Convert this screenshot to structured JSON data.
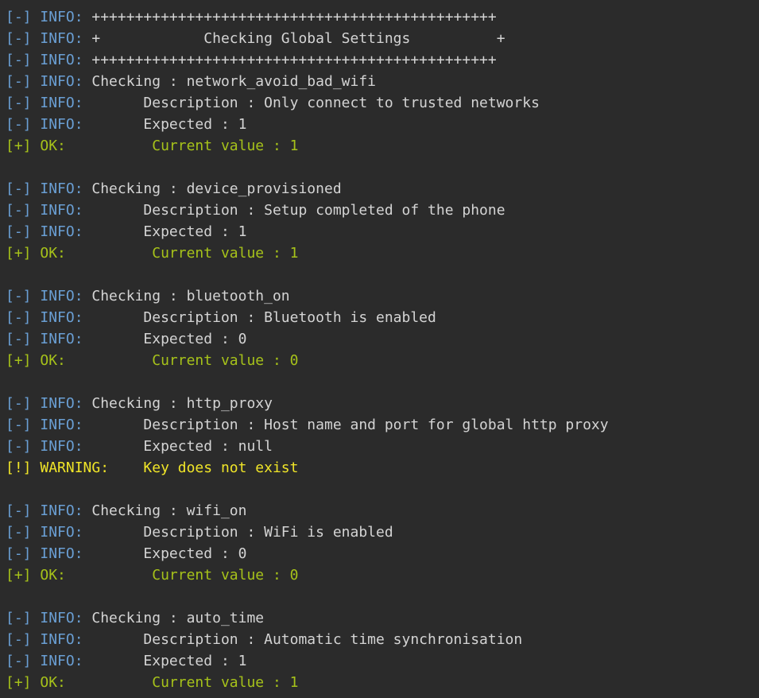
{
  "terminal": {
    "lines": [
      {
        "level": "info",
        "prefix": "[-]",
        "label": "INFO:",
        "text": " +++++++++++++++++++++++++++++++++++++++++++++++"
      },
      {
        "level": "info",
        "prefix": "[-]",
        "label": "INFO:",
        "text": " +            Checking Global Settings          +"
      },
      {
        "level": "info",
        "prefix": "[-]",
        "label": "INFO:",
        "text": " +++++++++++++++++++++++++++++++++++++++++++++++"
      },
      {
        "level": "info",
        "prefix": "[-]",
        "label": "INFO:",
        "text": " Checking : network_avoid_bad_wifi"
      },
      {
        "level": "info",
        "prefix": "[-]",
        "label": "INFO:",
        "text": "       Description : Only connect to trusted networks"
      },
      {
        "level": "info",
        "prefix": "[-]",
        "label": "INFO:",
        "text": "       Expected : 1"
      },
      {
        "level": "ok",
        "prefix": "[+]",
        "label": "OK:",
        "text": "          Current value : 1"
      },
      {
        "level": "blank"
      },
      {
        "level": "info",
        "prefix": "[-]",
        "label": "INFO:",
        "text": " Checking : device_provisioned"
      },
      {
        "level": "info",
        "prefix": "[-]",
        "label": "INFO:",
        "text": "       Description : Setup completed of the phone"
      },
      {
        "level": "info",
        "prefix": "[-]",
        "label": "INFO:",
        "text": "       Expected : 1"
      },
      {
        "level": "ok",
        "prefix": "[+]",
        "label": "OK:",
        "text": "          Current value : 1"
      },
      {
        "level": "blank"
      },
      {
        "level": "info",
        "prefix": "[-]",
        "label": "INFO:",
        "text": " Checking : bluetooth_on"
      },
      {
        "level": "info",
        "prefix": "[-]",
        "label": "INFO:",
        "text": "       Description : Bluetooth is enabled"
      },
      {
        "level": "info",
        "prefix": "[-]",
        "label": "INFO:",
        "text": "       Expected : 0"
      },
      {
        "level": "ok",
        "prefix": "[+]",
        "label": "OK:",
        "text": "          Current value : 0"
      },
      {
        "level": "blank"
      },
      {
        "level": "info",
        "prefix": "[-]",
        "label": "INFO:",
        "text": " Checking : http_proxy"
      },
      {
        "level": "info",
        "prefix": "[-]",
        "label": "INFO:",
        "text": "       Description : Host name and port for global http proxy"
      },
      {
        "level": "info",
        "prefix": "[-]",
        "label": "INFO:",
        "text": "       Expected : null"
      },
      {
        "level": "warning",
        "prefix": "[!]",
        "label": "WARNING:",
        "text": "    Key does not exist"
      },
      {
        "level": "blank"
      },
      {
        "level": "info",
        "prefix": "[-]",
        "label": "INFO:",
        "text": " Checking : wifi_on"
      },
      {
        "level": "info",
        "prefix": "[-]",
        "label": "INFO:",
        "text": "       Description : WiFi is enabled"
      },
      {
        "level": "info",
        "prefix": "[-]",
        "label": "INFO:",
        "text": "       Expected : 0"
      },
      {
        "level": "ok",
        "prefix": "[+]",
        "label": "OK:",
        "text": "          Current value : 0"
      },
      {
        "level": "blank"
      },
      {
        "level": "info",
        "prefix": "[-]",
        "label": "INFO:",
        "text": " Checking : auto_time"
      },
      {
        "level": "info",
        "prefix": "[-]",
        "label": "INFO:",
        "text": "       Description : Automatic time synchronisation"
      },
      {
        "level": "info",
        "prefix": "[-]",
        "label": "INFO:",
        "text": "       Expected : 1"
      },
      {
        "level": "ok",
        "prefix": "[+]",
        "label": "OK:",
        "text": "          Current value : 1"
      }
    ]
  },
  "colors": {
    "background": "#2b2b2b",
    "info_label": "#6a9fd4",
    "info_text": "#d4d4d4",
    "ok": "#a6c21a",
    "warning": "#f0e528"
  }
}
